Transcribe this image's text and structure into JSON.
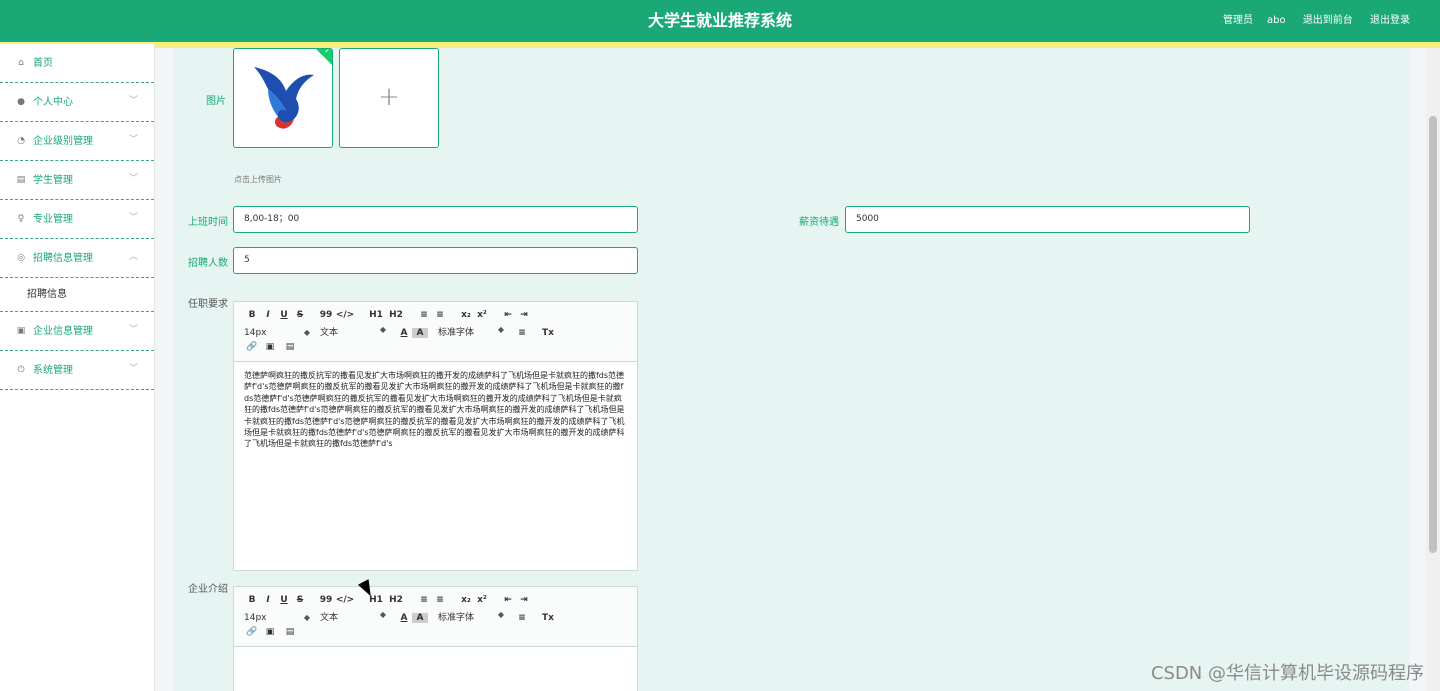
{
  "header": {
    "title": "大学生就业推荐系统",
    "admin_label": "管理员",
    "admin_name": "abo",
    "back_link": "退出到前台",
    "logout_link": "退出登录"
  },
  "sidebar": {
    "items": [
      {
        "label": "首页",
        "icon": "home-icon"
      },
      {
        "label": "个人中心",
        "icon": "user-icon"
      },
      {
        "label": "企业级别管理",
        "icon": "gauge-icon"
      },
      {
        "label": "学生管理",
        "icon": "chart-icon"
      },
      {
        "label": "专业管理",
        "icon": "microphone-icon"
      },
      {
        "label": "招聘信息管理",
        "icon": "support-icon"
      },
      {
        "label": "企业信息管理",
        "icon": "clipboard-icon"
      },
      {
        "label": "系统管理",
        "icon": "power-icon"
      }
    ],
    "sub_item": "招聘信息"
  },
  "form": {
    "image_label": "图片",
    "upload_hint": "点击上传图片",
    "work_time_label": "上班时间",
    "work_time_value": "8,00-18；00",
    "salary_label": "薪资待遇",
    "salary_value": "5000",
    "headcount_label": "招聘人数",
    "headcount_value": "5",
    "requirements_label": "任职要求",
    "company_intro_label": "企业介绍",
    "requirements_text": "范德萨啊疯狂的撒反抗军的撒看见发扩大市场啊疯狂的撒开发的成绩萨科了飞机场但是卡就疯狂的撒fds范德萨f'd's范德萨啊疯狂的撒反抗军的撒看见发扩大市场啊疯狂的撒开发的成绩萨科了飞机场但是卡就疯狂的撒fds范德萨f'd's范德萨啊疯狂的撒反抗军的撒看见发扩大市场啊疯狂的撒开发的成绩萨科了飞机场但是卡就疯狂的撒fds范德萨f'd's范德萨啊疯狂的撒反抗军的撒看见发扩大市场啊疯狂的撒开发的成绩萨科了飞机场但是卡就疯狂的撒fds范德萨f'd's范德萨啊疯狂的撒反抗军的撒看见发扩大市场啊疯狂的撒开发的成绩萨科了飞机场但是卡就疯狂的撒fds范德萨f'd's范德萨啊疯狂的撒反抗军的撒看见发扩大市场啊疯狂的撒开发的成绩萨科了飞机场但是卡就疯狂的撒fds范德萨f'd's"
  },
  "editor_toolbar": {
    "bold": "B",
    "italic": "I",
    "underline": "U",
    "strike": "S",
    "quote": "99",
    "code": "</>",
    "h1": "H1",
    "h2": "H2",
    "ol": "≡",
    "ul": "≡",
    "sub": "x₂",
    "sup": "x²",
    "outdent": "⇤",
    "indent": "⇥",
    "size": "14px",
    "type": "文本",
    "font_color": "A",
    "bg_color": "A",
    "font": "标准字体",
    "align": "≡",
    "clean": "Tx",
    "link": "🔗",
    "image": "▣",
    "video": "▤"
  },
  "watermark": "CSDN @华信计算机毕设源码程序",
  "colors": {
    "primary": "#1aa876",
    "accent_bar": "#f5f07e",
    "content_bg": "#e6f5f2"
  }
}
